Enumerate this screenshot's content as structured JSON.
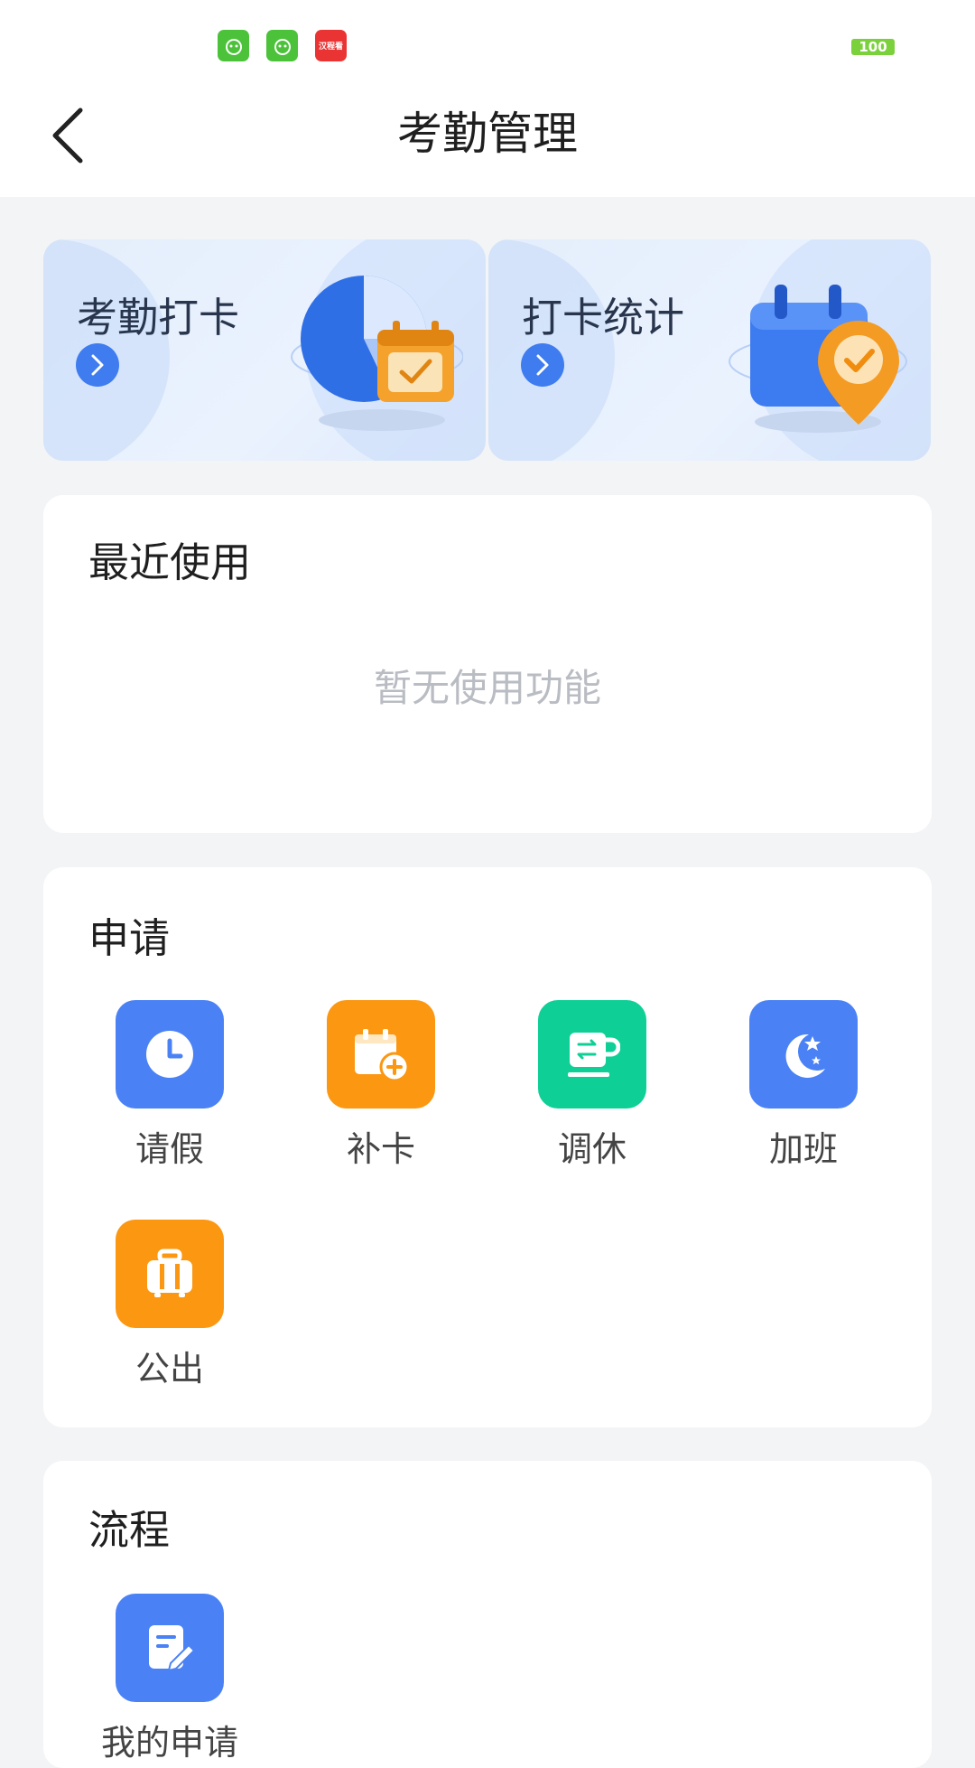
{
  "status_bar": {
    "notification_icons": [
      "app-icon",
      "app-icon",
      "news-app-icon"
    ],
    "news_icon_text": "汉程看",
    "battery": "100"
  },
  "nav": {
    "title": "考勤管理",
    "back_icon": "chevron-left-icon"
  },
  "banners": [
    {
      "label": "考勤打卡",
      "icon": "pie-chart-calendar-icon"
    },
    {
      "label": "打卡统计",
      "icon": "calendar-location-check-icon"
    }
  ],
  "recent": {
    "title": "最近使用",
    "empty_text": "暂无使用功能"
  },
  "apply": {
    "title": "申请",
    "items": [
      {
        "label": "请假",
        "icon": "clock-icon",
        "color": "#4a82f6"
      },
      {
        "label": "补卡",
        "icon": "calendar-add-icon",
        "color": "#fb9711"
      },
      {
        "label": "调休",
        "icon": "swap-cup-icon",
        "color": "#0ed097"
      },
      {
        "label": "加班",
        "icon": "moon-stars-icon",
        "color": "#4a82f6"
      },
      {
        "label": "公出",
        "icon": "suitcase-icon",
        "color": "#fb9711"
      }
    ]
  },
  "flow": {
    "title": "流程",
    "items": [
      {
        "label": "我的申请",
        "icon": "document-edit-icon",
        "color": "#4a82f6"
      }
    ]
  }
}
